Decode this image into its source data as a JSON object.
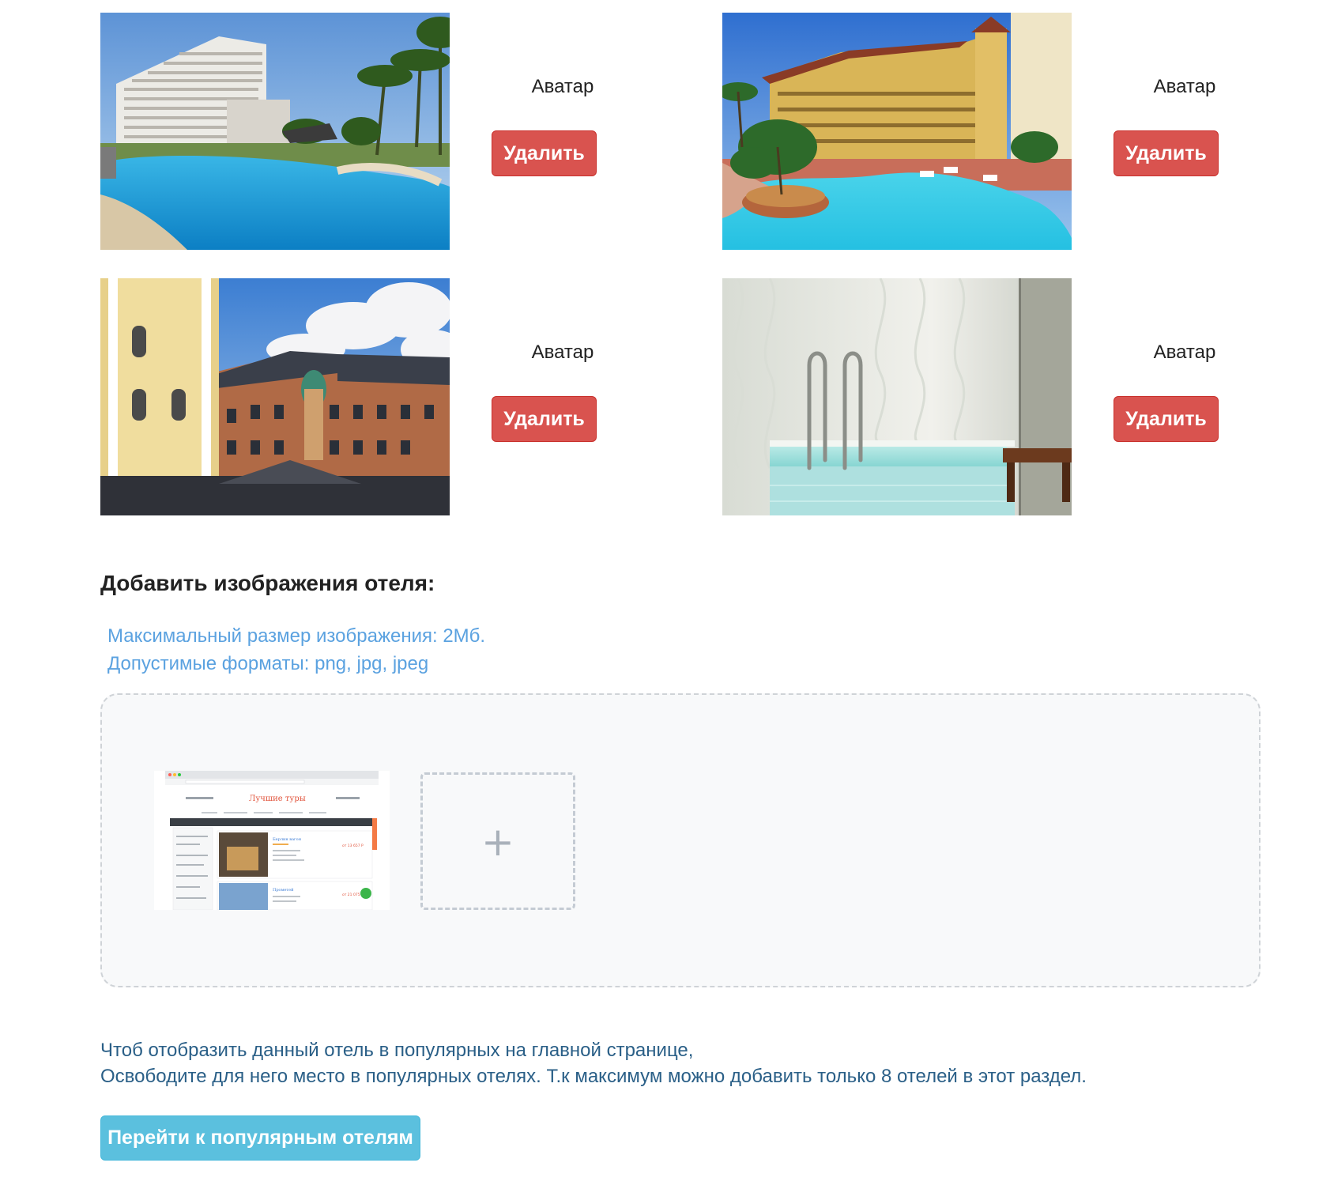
{
  "gallery": {
    "items": [
      {
        "image_icon": "hotel-pool-photo",
        "caption": "Аватар",
        "delete_label": "Удалить"
      },
      {
        "image_icon": "resort-pool-photo",
        "caption": "Аватар",
        "delete_label": "Удалить"
      },
      {
        "image_icon": "historic-building-photo",
        "caption": "Аватар",
        "delete_label": "Удалить"
      },
      {
        "image_icon": "indoor-pool-photo",
        "caption": "Аватар",
        "delete_label": "Удалить"
      }
    ]
  },
  "upload": {
    "title": "Добавить изображения отеля:",
    "max_size": "Максимальный размер изображения: 2Мб.",
    "formats": "Допустимые форматы: png, jpg, jpeg",
    "preview_icon": "website-screenshot-thumbnail",
    "preview_text": {
      "logo": "Лучшие туры",
      "hotel_1": "Берлин вагон",
      "price_1": "от 13 657 Р",
      "hotel_2": "Прометей",
      "price_2": "от 21 075 Р"
    },
    "add_symbol": "+"
  },
  "popular": {
    "line1": "Чтоб отобразить данный отель в популярных на главной странице,",
    "line2": "Освободите для него место в популярных отелях. Т.к максимум можно добавить только 8 отелей в этот раздел.",
    "button_label": "Перейти к популярным отелям"
  },
  "colors": {
    "danger": "#d9534f",
    "info": "#5bc0de",
    "hint": "#5ba2e0",
    "note": "#2a5f87"
  }
}
